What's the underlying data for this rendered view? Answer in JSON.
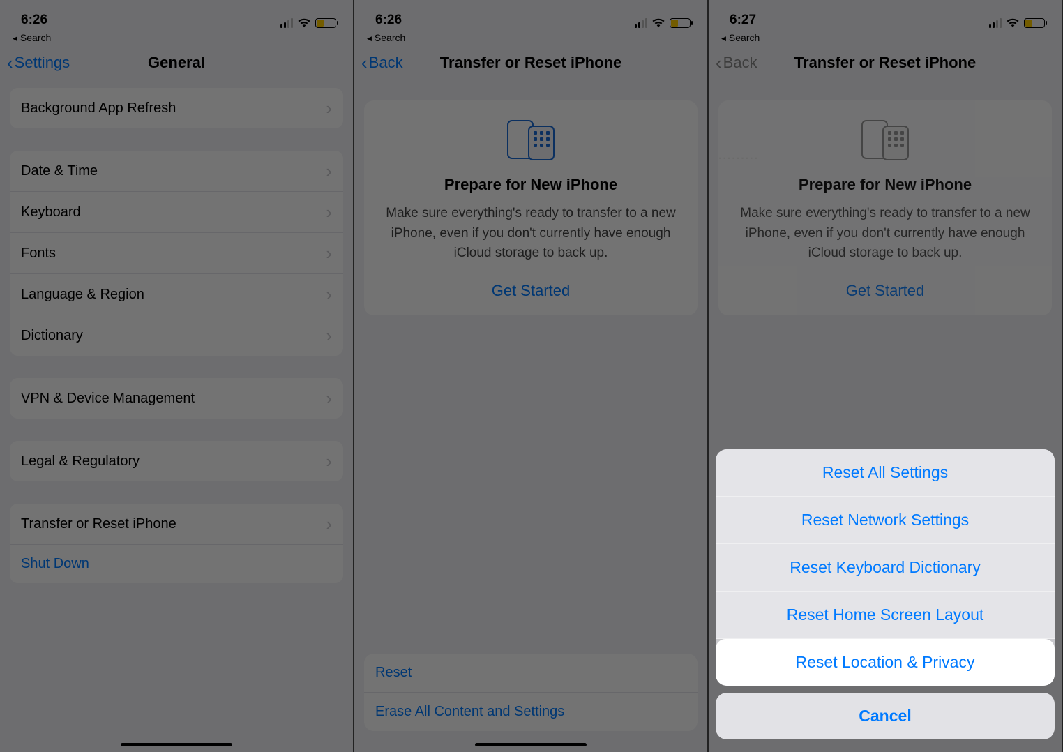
{
  "status": {
    "time1": "6:26",
    "time2": "6:26",
    "time3": "6:27",
    "back_app": "Search"
  },
  "screen1": {
    "nav_back": "Settings",
    "nav_title": "General",
    "rows": {
      "bg_refresh": "Background App Refresh",
      "date_time": "Date & Time",
      "keyboard": "Keyboard",
      "fonts": "Fonts",
      "lang_region": "Language & Region",
      "dictionary": "Dictionary",
      "vpn": "VPN & Device Management",
      "legal": "Legal & Regulatory",
      "transfer_reset": "Transfer or Reset iPhone",
      "shut_down": "Shut Down"
    }
  },
  "screen2": {
    "nav_back": "Back",
    "nav_title": "Transfer or Reset iPhone",
    "card_title": "Prepare for New iPhone",
    "card_text": "Make sure everything's ready to transfer to a new iPhone, even if you don't currently have enough iCloud storage to back up.",
    "get_started": "Get Started",
    "reset": "Reset",
    "erase": "Erase All Content and Settings"
  },
  "screen3": {
    "nav_back": "Back",
    "nav_title": "Transfer or Reset iPhone",
    "card_title": "Prepare for New iPhone",
    "card_text": "Make sure everything's ready to transfer to a new iPhone, even if you don't currently have enough iCloud storage to back up.",
    "get_started": "Get Started",
    "sheet": {
      "reset_all": "Reset All Settings",
      "reset_network": "Reset Network Settings",
      "reset_keyboard": "Reset Keyboard Dictionary",
      "reset_home": "Reset Home Screen Layout",
      "reset_location": "Reset Location & Privacy",
      "cancel": "Cancel"
    }
  }
}
